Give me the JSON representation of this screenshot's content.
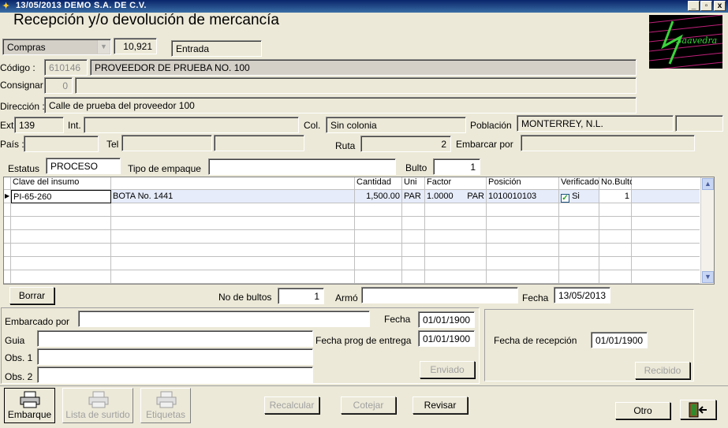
{
  "window": {
    "title": "13/05/2013 DEMO S.A. DE C.V.",
    "minimize": "_",
    "restore": "▫",
    "close": "x"
  },
  "page_title": "Recepción y/o devolución de mercancía",
  "header": {
    "tipo": "Compras",
    "folio": "10,921",
    "movimiento": "Entrada"
  },
  "labels": {
    "codigo": "Código :",
    "consignar": "Consignar",
    "direccion": "Dirección :",
    "ext": "Ext.",
    "int": "Int.",
    "col": "Col.",
    "poblacion": "Población",
    "pais": "País :",
    "tel": "Tel",
    "ruta": "Ruta",
    "embarcar_por": "Embarcar por",
    "estatus": "Estatus",
    "tipo_empaque": "Tipo de empaque",
    "bulto": "Bulto",
    "no_bultos": "No de bultos",
    "armo": "Armó",
    "fecha": "Fecha",
    "embarcado_por": "Embarcado por",
    "guia": "Guia",
    "obs1": "Obs. 1",
    "obs2": "Obs. 2",
    "fecha2": "Fecha",
    "fecha_prog": "Fecha prog de entrega",
    "fecha_recepcion": "Fecha de recepción"
  },
  "values": {
    "codigo": "610146",
    "proveedor": "PROVEEDOR DE PRUEBA NO. 100",
    "consignar": "0",
    "direccion": "Calle de prueba del proveedor 100",
    "ext": "139",
    "colonia": "Sin colonia",
    "poblacion": "MONTERREY, N.L.",
    "ruta": "2",
    "estatus": "PROCESO",
    "bulto": "1",
    "no_bultos": "1",
    "fecha": "13/05/2013",
    "fecha_embarque": "01/01/1900",
    "fecha_prog": "01/01/1900",
    "fecha_recepcion": "01/01/1900"
  },
  "grid": {
    "columns": [
      "Clave del insumo",
      "",
      "Cantidad",
      "Uni",
      "Factor",
      "Posición",
      "Verificado",
      "No.Bulto"
    ],
    "row": {
      "clave": "PI-65-260",
      "descripcion": "BOTA No. 1441",
      "cantidad": "1,500.00",
      "uni": "PAR",
      "factor": "1.0000",
      "factor_uni": "PAR",
      "posicion": "1010010103",
      "verificado": "Si",
      "bulto": "1"
    }
  },
  "buttons": {
    "borrar": "Borrar",
    "enviado": "Enviado",
    "recibido": "Recibido",
    "recalcular": "Recalcular",
    "cotejar": "Cotejar",
    "revisar": "Revisar",
    "otro": "Otro"
  },
  "toolbar": {
    "embarque": "Embarque",
    "lista_surtido": "Lista de surtido",
    "etiquetas": "Etiquetas"
  },
  "logo_text": "Saavedra"
}
